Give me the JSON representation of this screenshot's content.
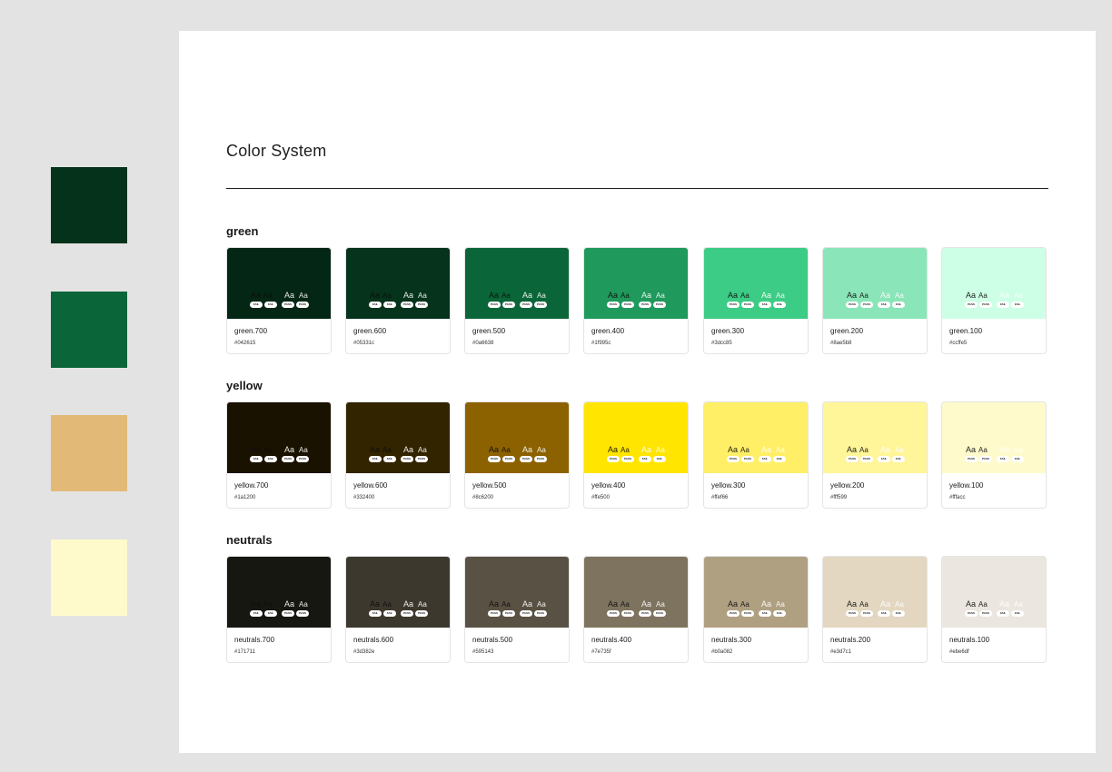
{
  "page_title": "Color System",
  "side_swatches": [
    "#04321b",
    "#0a6638",
    "#e3b978",
    "#fffacc"
  ],
  "groups": [
    {
      "name": "green",
      "swatches": [
        {
          "name": "green.700",
          "hex": "#042615",
          "fill": "#042615",
          "light_text": true,
          "pills": [
            "FAIL",
            "FAIL",
            "PASS",
            "PASS"
          ]
        },
        {
          "name": "green.600",
          "hex": "#05331c",
          "fill": "#05331c",
          "light_text": true,
          "pills": [
            "FAIL",
            "FAIL",
            "PASS",
            "PASS"
          ]
        },
        {
          "name": "green.500",
          "hex": "#0a6638",
          "fill": "#0a6638",
          "light_text": true,
          "pills": [
            "PASS",
            "PASS",
            "PASS",
            "PASS"
          ]
        },
        {
          "name": "green.400",
          "hex": "#1f995c",
          "fill": "#1f995c",
          "light_text": true,
          "pills": [
            "PASS",
            "PASS",
            "PASS",
            "PASS"
          ]
        },
        {
          "name": "green.300",
          "hex": "#3dcc85",
          "fill": "#3dcc85",
          "light_text": false,
          "pills": [
            "PASS",
            "PASS",
            "FAIL",
            "FAIL"
          ]
        },
        {
          "name": "green.200",
          "hex": "#8ae5b8",
          "fill": "#8ae5b8",
          "light_text": false,
          "pills": [
            "PASS",
            "PASS",
            "FAIL",
            "FAIL"
          ]
        },
        {
          "name": "green.100",
          "hex": "#ccffe5",
          "fill": "#ccffe5",
          "light_text": false,
          "pills": [
            "PASS",
            "PASS",
            "FAIL",
            "FAIL"
          ]
        }
      ]
    },
    {
      "name": "yellow",
      "swatches": [
        {
          "name": "yellow.700",
          "hex": "#1a1200",
          "fill": "#1a1200",
          "light_text": true,
          "pills": [
            "FAIL",
            "FAIL",
            "PASS",
            "PASS"
          ]
        },
        {
          "name": "yellow.600",
          "hex": "#332400",
          "fill": "#332400",
          "light_text": true,
          "pills": [
            "FAIL",
            "FAIL",
            "PASS",
            "PASS"
          ]
        },
        {
          "name": "yellow.500",
          "hex": "#8c6200",
          "fill": "#8c6200",
          "light_text": true,
          "pills": [
            "PASS",
            "PASS",
            "PASS",
            "PASS"
          ]
        },
        {
          "name": "yellow.400",
          "hex": "#ffe500",
          "fill": "#ffe500",
          "light_text": false,
          "pills": [
            "PASS",
            "PASS",
            "FAIL",
            "FAIL"
          ]
        },
        {
          "name": "yellow.300",
          "hex": "#ffef66",
          "fill": "#ffef66",
          "light_text": false,
          "pills": [
            "PASS",
            "PASS",
            "FAIL",
            "FAIL"
          ]
        },
        {
          "name": "yellow.200",
          "hex": "#fff599",
          "fill": "#fff599",
          "light_text": false,
          "pills": [
            "PASS",
            "PASS",
            "FAIL",
            "FAIL"
          ]
        },
        {
          "name": "yellow.100",
          "hex": "#fffacc",
          "fill": "#fffacc",
          "light_text": false,
          "pills": [
            "PASS",
            "PASS",
            "FAIL",
            "FAIL"
          ]
        }
      ]
    },
    {
      "name": "neutrals",
      "swatches": [
        {
          "name": "neutrals.700",
          "hex": "#171711",
          "fill": "#171711",
          "light_text": true,
          "pills": [
            "FAIL",
            "FAIL",
            "PASS",
            "PASS"
          ]
        },
        {
          "name": "neutrals.600",
          "hex": "#3d382e",
          "fill": "#3d382e",
          "light_text": true,
          "pills": [
            "FAIL",
            "FAIL",
            "PASS",
            "PASS"
          ]
        },
        {
          "name": "neutrals.500",
          "hex": "#595143",
          "fill": "#595143",
          "light_text": true,
          "pills": [
            "PASS",
            "PASS",
            "PASS",
            "PASS"
          ]
        },
        {
          "name": "neutrals.400",
          "hex": "#7e735f",
          "fill": "#7e735f",
          "light_text": true,
          "pills": [
            "PASS",
            "PASS",
            "PASS",
            "PASS"
          ]
        },
        {
          "name": "neutrals.300",
          "hex": "#b0a082",
          "fill": "#b0a082",
          "light_text": false,
          "pills": [
            "PASS",
            "PASS",
            "FAIL",
            "FAIL"
          ]
        },
        {
          "name": "neutrals.200",
          "hex": "#e3d7c1",
          "fill": "#e3d7c1",
          "light_text": false,
          "pills": [
            "PASS",
            "PASS",
            "FAIL",
            "FAIL"
          ]
        },
        {
          "name": "neutrals.100",
          "hex": "#ebe6df",
          "fill": "#ebe6df",
          "light_text": false,
          "pills": [
            "PASS",
            "PASS",
            "FAIL",
            "FAIL"
          ]
        }
      ]
    }
  ]
}
